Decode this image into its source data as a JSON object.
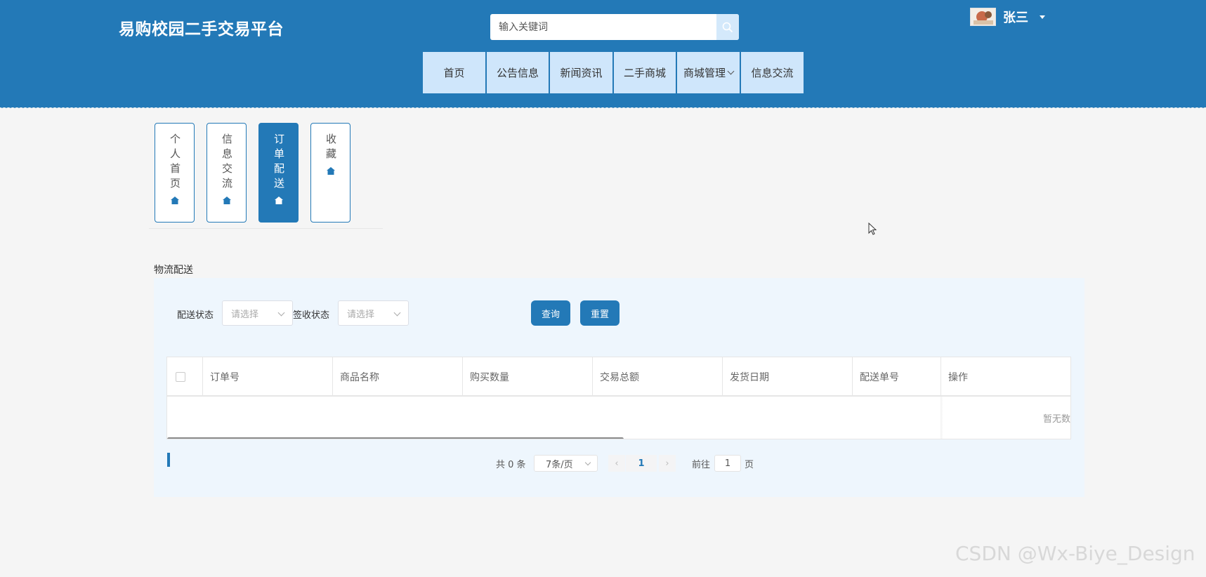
{
  "header": {
    "site_title": "易购校园二手交易平台",
    "search_placeholder": "输入关键词",
    "username": "张三"
  },
  "nav": {
    "items": [
      "首页",
      "公告信息",
      "新闻资讯",
      "二手商城",
      "商城管理",
      "信息交流"
    ]
  },
  "side_tabs": [
    "个人首页",
    "信息交流",
    "订单配送",
    "收藏"
  ],
  "active_side_tab": "订单配送",
  "section": {
    "title": "物流配送",
    "filters": {
      "delivery_status_label": "配送状态",
      "delivery_status_placeholder": "请选择",
      "receipt_status_label": "签收状态",
      "receipt_status_placeholder": "请选择"
    },
    "query_button": "查询",
    "reset_button": "重置"
  },
  "table": {
    "columns": [
      "订单号",
      "商品名称",
      "购买数量",
      "交易总额",
      "发货日期",
      "配送单号",
      "操作"
    ],
    "rows": [],
    "empty_text": "暂无数"
  },
  "pagination": {
    "total_text": "共 0 条",
    "page_size": "7条/页",
    "current_page": "1",
    "goto_label": "前往",
    "goto_value": "1",
    "page_unit": "页",
    "prev_icon": "‹",
    "next_icon": "›"
  },
  "watermark": "CSDN @Wx-Biye_Design",
  "colors": {
    "primary": "#2379b7",
    "nav_bg": "#cfe6fb",
    "panel_bg": "#eef6fd"
  }
}
